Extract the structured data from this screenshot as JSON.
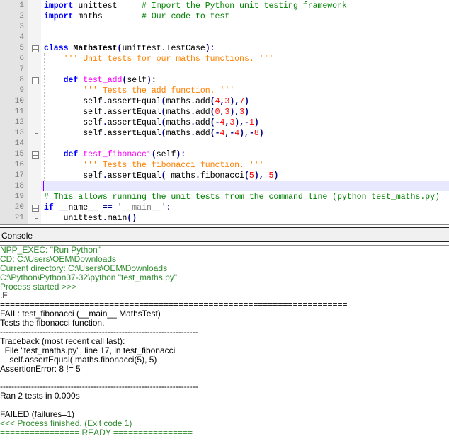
{
  "editor": {
    "lines": [
      [
        [
          "kw",
          "import"
        ],
        [
          "",
          "unittest     "
        ],
        [
          "com",
          "# Import the Python unit testing framework"
        ]
      ],
      [
        [
          "kw",
          "import"
        ],
        [
          "",
          "maths        "
        ],
        [
          "com",
          "# Our code to test"
        ]
      ],
      [],
      [],
      [
        [
          "kw",
          "class"
        ],
        [
          "cls",
          " MathsTest"
        ],
        [
          "op",
          "("
        ],
        [
          "",
          "unittest"
        ],
        [
          "op",
          "."
        ],
        [
          "",
          "TestCase"
        ],
        [
          "op",
          "):"
        ]
      ],
      [
        [
          "doc",
          "    ''' Unit tests for our maths functions. '''"
        ]
      ],
      [],
      [
        [
          "kw",
          "    def"
        ],
        [
          "fn",
          " test_add"
        ],
        [
          "op",
          "("
        ],
        [
          "",
          "self"
        ],
        [
          "op",
          "):"
        ]
      ],
      [
        [
          "doc",
          "        ''' Tests the add function. '''"
        ]
      ],
      [
        [
          "",
          "        self"
        ],
        [
          "op",
          "."
        ],
        [
          "",
          "assertEqual"
        ],
        [
          "op",
          "("
        ],
        [
          "",
          "maths"
        ],
        [
          "op",
          "."
        ],
        [
          "",
          "add"
        ],
        [
          "op",
          "("
        ],
        [
          "num",
          "4"
        ],
        [
          "op",
          ","
        ],
        [
          "num",
          "3"
        ],
        [
          "op",
          "),"
        ],
        [
          "num",
          "7"
        ],
        [
          "op",
          ")"
        ]
      ],
      [
        [
          "",
          "        self"
        ],
        [
          "op",
          "."
        ],
        [
          "",
          "assertEqual"
        ],
        [
          "op",
          "("
        ],
        [
          "",
          "maths"
        ],
        [
          "op",
          "."
        ],
        [
          "",
          "add"
        ],
        [
          "op",
          "("
        ],
        [
          "num",
          "0"
        ],
        [
          "op",
          ","
        ],
        [
          "num",
          "3"
        ],
        [
          "op",
          "),"
        ],
        [
          "num",
          "3"
        ],
        [
          "op",
          ")"
        ]
      ],
      [
        [
          "",
          "        self"
        ],
        [
          "op",
          "."
        ],
        [
          "",
          "assertEqual"
        ],
        [
          "op",
          "("
        ],
        [
          "",
          "maths"
        ],
        [
          "op",
          "."
        ],
        [
          "",
          "add"
        ],
        [
          "op",
          "(-"
        ],
        [
          "num",
          "4"
        ],
        [
          "op",
          ","
        ],
        [
          "num",
          "3"
        ],
        [
          "op",
          "),-"
        ],
        [
          "num",
          "1"
        ],
        [
          "op",
          ")"
        ]
      ],
      [
        [
          "",
          "        self"
        ],
        [
          "op",
          "."
        ],
        [
          "",
          "assertEqual"
        ],
        [
          "op",
          "("
        ],
        [
          "",
          "maths"
        ],
        [
          "op",
          "."
        ],
        [
          "",
          "add"
        ],
        [
          "op",
          "(-"
        ],
        [
          "num",
          "4"
        ],
        [
          "op",
          ",-"
        ],
        [
          "num",
          "4"
        ],
        [
          "op",
          "),-"
        ],
        [
          "num",
          "8"
        ],
        [
          "op",
          ")"
        ]
      ],
      [],
      [
        [
          "kw",
          "    def"
        ],
        [
          "fn",
          " test_fibonacci"
        ],
        [
          "op",
          "("
        ],
        [
          "",
          "self"
        ],
        [
          "op",
          "):"
        ]
      ],
      [
        [
          "doc",
          "        ''' Tests the fibonacci function. '''"
        ]
      ],
      [
        [
          "",
          "        self"
        ],
        [
          "op",
          "."
        ],
        [
          "",
          "assertEqual"
        ],
        [
          "op",
          "("
        ],
        [
          "",
          " maths"
        ],
        [
          "op",
          "."
        ],
        [
          "",
          "fibonacci"
        ],
        [
          "op",
          "("
        ],
        [
          "num",
          "5"
        ],
        [
          "op",
          "),"
        ],
        [
          "num",
          " 5"
        ],
        [
          "op",
          ")"
        ]
      ],
      [],
      [
        [
          "com",
          "# This allows running the unit tests from the command line (python test_maths.py)"
        ]
      ],
      [
        [
          "kw",
          "if"
        ],
        [
          "",
          " __name__ "
        ],
        [
          "op",
          "=="
        ],
        [
          "s",
          " '__main__'"
        ],
        [
          "op",
          ":"
        ]
      ],
      [
        [
          "",
          "    unittest"
        ],
        [
          "op",
          "."
        ],
        [
          "",
          "main"
        ],
        [
          "op",
          "()"
        ]
      ]
    ]
  },
  "console": {
    "title": "Console",
    "lines": [
      [
        "g",
        "NPP_EXEC: \"Run Python\""
      ],
      [
        "g",
        "CD: C:\\Users\\OEM\\Downloads"
      ],
      [
        "g",
        "Current directory: C:\\Users\\OEM\\Downloads"
      ],
      [
        "g",
        "C:\\Python\\Python37-32\\python \"test_maths.py\""
      ],
      [
        "g",
        "Process started >>>"
      ],
      [
        "",
        ".F"
      ],
      [
        "",
        "======================================================================"
      ],
      [
        "",
        "FAIL: test_fibonacci (__main__.MathsTest)"
      ],
      [
        "",
        "Tests the fibonacci function."
      ],
      [
        "",
        "----------------------------------------------------------------------"
      ],
      [
        "",
        "Traceback (most recent call last):"
      ],
      [
        "",
        "  File \"test_maths.py\", line 17, in test_fibonacci"
      ],
      [
        "",
        "    self.assertEqual( maths.fibonacci(5), 5)"
      ],
      [
        "",
        "AssertionError: 8 != 5"
      ],
      [
        "",
        ""
      ],
      [
        "",
        "----------------------------------------------------------------------"
      ],
      [
        "",
        "Ran 2 tests in 0.000s"
      ],
      [
        "",
        ""
      ],
      [
        "",
        "FAILED (failures=1)"
      ],
      [
        "g",
        "<<< Process finished. (Exit code 1)"
      ],
      [
        "g",
        "================ READY ================"
      ]
    ]
  }
}
